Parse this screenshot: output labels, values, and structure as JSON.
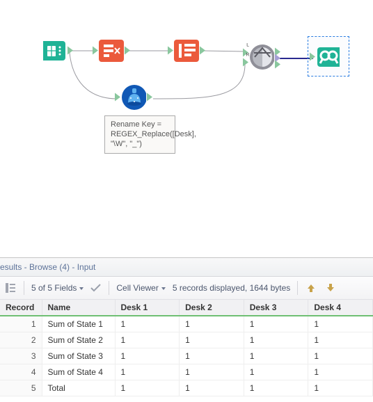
{
  "canvas": {
    "tools": {
      "input": {
        "name": "input-data-tool"
      },
      "select": {
        "name": "select-tool"
      },
      "transpose": {
        "name": "crosstab-tool"
      },
      "join": {
        "name": "join-tool"
      },
      "browse": {
        "name": "browse-tool"
      },
      "formula": {
        "name": "formula-tool"
      }
    },
    "join_port_L": "L",
    "join_port_R": "R",
    "annotation": "Rename Key = REGEX_Replace([Desk], \"\\W\", \"_\")"
  },
  "results": {
    "panel_title": "esults - Browse (4) - Input",
    "fields_summary": "5 of 5 Fields",
    "cell_viewer_label": "Cell Viewer",
    "records_summary": "5 records displayed, 1644 bytes",
    "columns": {
      "record": "Record",
      "name": "Name",
      "d1": "Desk 1",
      "d2": "Desk 2",
      "d3": "Desk 3",
      "d4": "Desk 4"
    },
    "rows": [
      {
        "rec": "1",
        "name": "Sum of State 1",
        "d1": "1",
        "d2": "1",
        "d3": "1",
        "d4": "1"
      },
      {
        "rec": "2",
        "name": "Sum of State 2",
        "d1": "1",
        "d2": "1",
        "d3": "1",
        "d4": "1"
      },
      {
        "rec": "3",
        "name": "Sum of State 3",
        "d1": "1",
        "d2": "1",
        "d3": "1",
        "d4": "1"
      },
      {
        "rec": "4",
        "name": "Sum of State 4",
        "d1": "1",
        "d2": "1",
        "d3": "1",
        "d4": "1"
      },
      {
        "rec": "5",
        "name": "Total",
        "d1": "1",
        "d2": "1",
        "d3": "1",
        "d4": "1"
      }
    ]
  }
}
